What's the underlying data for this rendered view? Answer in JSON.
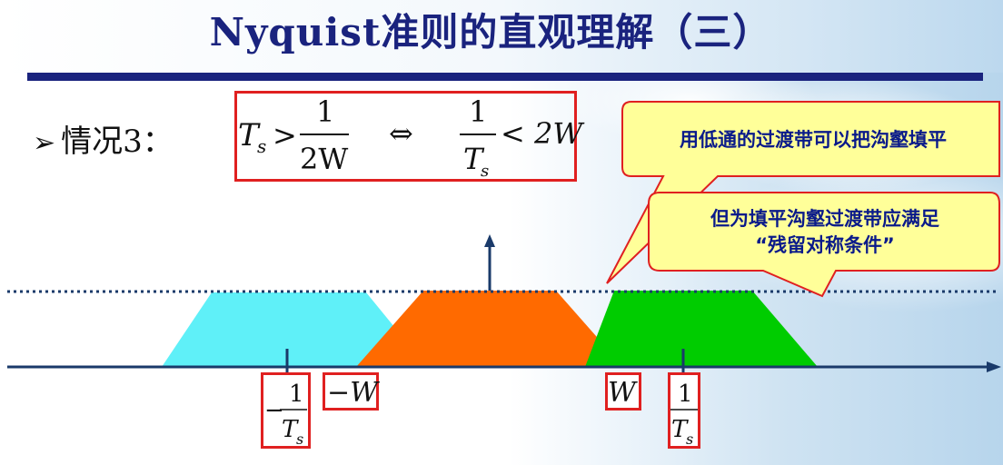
{
  "title": "Nyquist准则的直观理解（三）",
  "case": {
    "bullet": "➢",
    "label": "情况3："
  },
  "formula": {
    "left_lhs": "T",
    "left_sub": "s",
    "left_op": ">",
    "left_num": "1",
    "left_den": "2W",
    "equiv": "⇔",
    "right_num": "1",
    "right_den": "T",
    "right_den_sub": "s",
    "right_op": "< 2W"
  },
  "callouts": {
    "top": "用低通的过渡带可以把沟壑填平",
    "bottom_line1": "但为填平沟壑过渡带应满足",
    "bottom_line2": "“残留对称条件”"
  },
  "axis_labels": {
    "neg_inv_ts_sign": "−",
    "neg_inv_ts_num": "1",
    "neg_inv_ts_den": "T",
    "neg_inv_ts_sub": "s",
    "neg_w": "−W",
    "pos_w": "W",
    "pos_inv_ts_num": "1",
    "pos_inv_ts_den": "T",
    "pos_inv_ts_sub": "s"
  },
  "colors": {
    "title": "#1a237e",
    "left_shape": "#5ff0f8",
    "center_shape": "#ff6a00",
    "right_shape": "#00cc00",
    "axis": "#1a3a6a",
    "box_border": "#e02020",
    "callout_fill": "#ffff99",
    "callout_border": "#e02020",
    "callout_text": "#0a1a8a"
  }
}
